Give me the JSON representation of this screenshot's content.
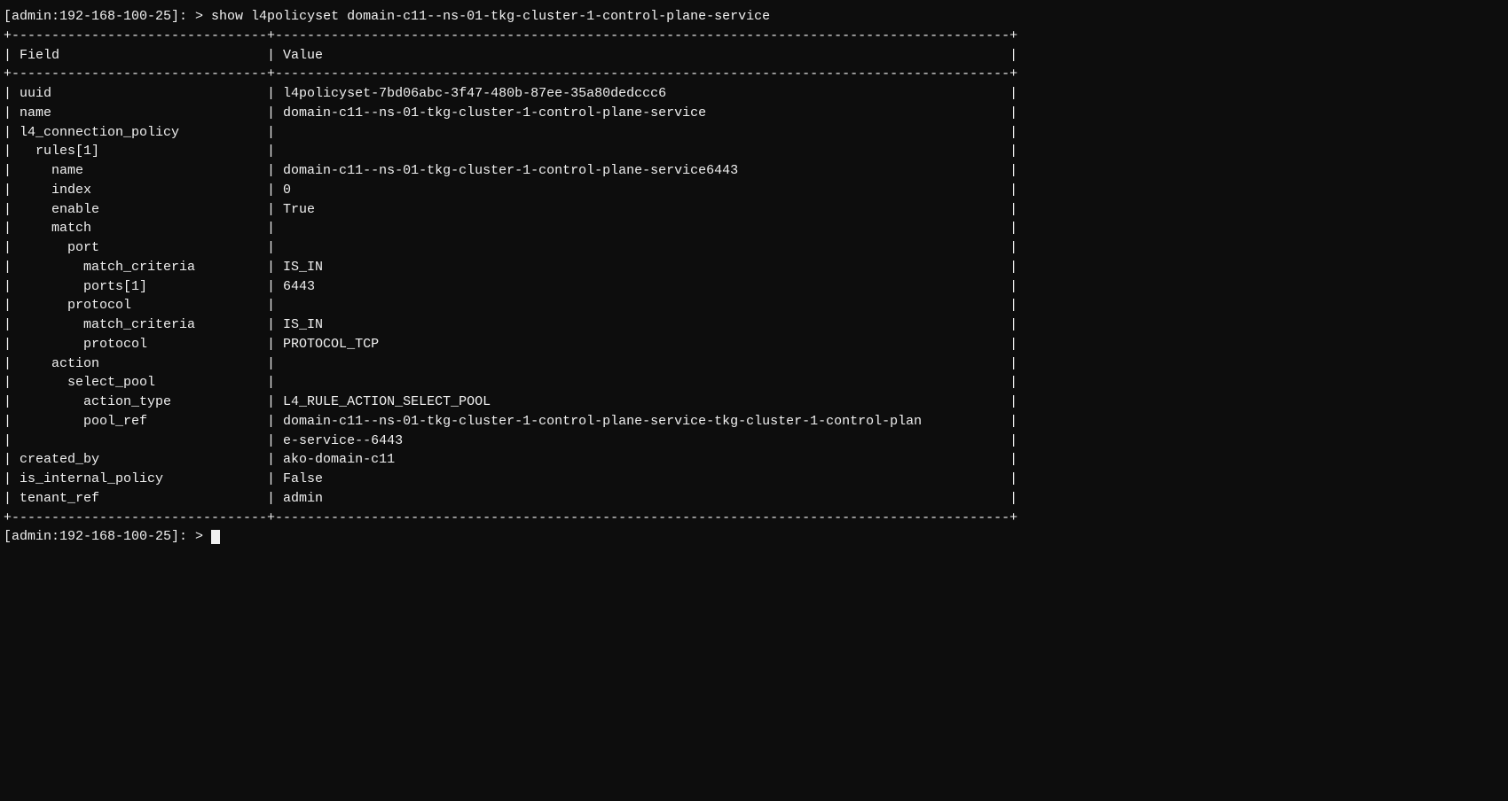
{
  "terminal": {
    "prompt": "[admin:192-168-100-25]: > ",
    "command": "show l4policyset domain-c11--ns-01-tkg-cluster-1-control-plane-service",
    "separator_top": "+--------------------------------+--------------------------------------------------------------------------------------------+",
    "header_row": "| Field                          | Value                                                                                      |",
    "separator_mid": "+--------------------------------+--------------------------------------------------------------------------------------------+",
    "rows": [
      "| uuid                           | l4policyset-7bd06abc-3f47-480b-87ee-35a80dedccc6                                           |",
      "| name                           | domain-c11--ns-01-tkg-cluster-1-control-plane-service                                      |",
      "| l4_connection_policy           |                                                                                            |",
      "|   rules[1]                     |                                                                                            |",
      "|     name                       | domain-c11--ns-01-tkg-cluster-1-control-plane-service6443                                  |",
      "|     index                      | 0                                                                                          |",
      "|     enable                     | True                                                                                       |",
      "|     match                      |                                                                                            |",
      "|       port                     |                                                                                            |",
      "|         match_criteria         | IS_IN                                                                                      |",
      "|         ports[1]               | 6443                                                                                       |",
      "|       protocol                 |                                                                                            |",
      "|         match_criteria         | IS_IN                                                                                      |",
      "|         protocol               | PROTOCOL_TCP                                                                               |",
      "|     action                     |                                                                                            |",
      "|       select_pool              |                                                                                            |",
      "|         action_type            | L4_RULE_ACTION_SELECT_POOL                                                                 |",
      "|         pool_ref               | domain-c11--ns-01-tkg-cluster-1-control-plane-service-tkg-cluster-1-control-plan           |",
      "|                                | e-service--6443                                                                            |",
      "| created_by                     | ako-domain-c11                                                                             |",
      "| is_internal_policy             | False                                                                                      |",
      "| tenant_ref                     | admin                                                                                      |"
    ],
    "separator_bottom": "+--------------------------------+--------------------------------------------------------------------------------------------+",
    "prompt_end": "[admin:192-168-100-25]: > "
  }
}
